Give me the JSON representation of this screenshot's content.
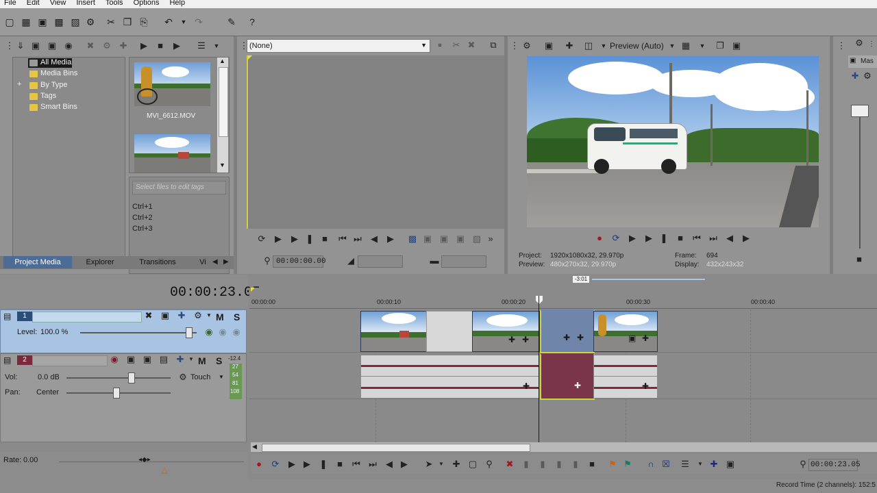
{
  "menu": [
    "File",
    "Edit",
    "View",
    "Insert",
    "Tools",
    "Options",
    "Help"
  ],
  "tree": {
    "items": [
      "All Media",
      "Media Bins",
      "By Type",
      "Tags",
      "Smart Bins"
    ],
    "expand_symbol": "+"
  },
  "media": {
    "thumb1_label": "MVI_6612.MOV",
    "tags_placeholder": "Select files to edit tags",
    "shortcuts": [
      "Ctrl+1",
      "Ctrl+2",
      "Ctrl+3"
    ]
  },
  "left_tabs": [
    "Project Media",
    "Explorer",
    "Transitions",
    "Vi"
  ],
  "trimmer": {
    "dropdown_value": "(None)",
    "timecode": "00:00:00.00"
  },
  "preview": {
    "mode_label": "Preview (Auto)",
    "project_label": "Project:",
    "project_value": "1920x1080x32, 29.970p",
    "preview_label": "Preview:",
    "preview_value": "480x270x32, 29.970p",
    "frame_label": "Frame:",
    "frame_value": "694",
    "display_label": "Display:",
    "display_value": "432x243x32"
  },
  "mixer": {
    "tab_label": "Mas"
  },
  "timeline": {
    "current_time": "00:00:23.05",
    "marker_label": "-3:01",
    "ruler": [
      "00:00:00",
      "00:00:10",
      "00:00:20",
      "00:00:30",
      "00:00:40"
    ],
    "bottom_time": "00:00:23.05",
    "record_time": "Record Time (2 channels): 152:5"
  },
  "track1": {
    "number": "1",
    "level_label": "Level:",
    "level_value": "100.0 %",
    "mute": "M",
    "solo": "S"
  },
  "track2": {
    "number": "2",
    "vol_label": "Vol:",
    "vol_value": "0.0 dB",
    "pan_label": "Pan:",
    "pan_value": "Center",
    "touch_label": "Touch",
    "mute": "M",
    "solo": "S",
    "meter_values": [
      "-12.4",
      "27",
      "54",
      "81",
      "108"
    ]
  },
  "rate": {
    "label": "Rate:",
    "value": "0.00"
  },
  "icons": [
    "new-icon",
    "open-icon",
    "save-icon",
    "save-as-icon",
    "render-icon",
    "properties-icon",
    "cut-icon",
    "copy-icon",
    "paste-icon",
    "delete-icon",
    "undo-icon",
    "redo-icon",
    "snapshot-icon",
    "help-icon",
    "play-icon",
    "pause-icon",
    "stop-icon",
    "loop-icon",
    "settings-icon",
    "lock-icon"
  ]
}
